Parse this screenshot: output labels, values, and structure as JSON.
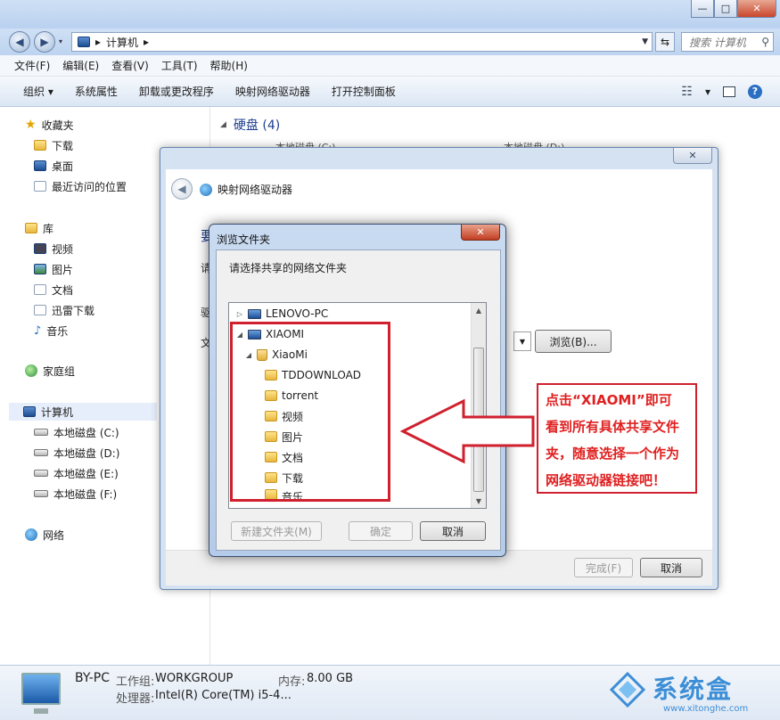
{
  "window": {
    "minimize": "—",
    "maximize": "□",
    "close": "✕"
  },
  "address": {
    "path": "计算机",
    "separator": "▸",
    "search_placeholder": "搜索 计算机"
  },
  "menu": [
    "文件(F)",
    "编辑(E)",
    "查看(V)",
    "工具(T)",
    "帮助(H)"
  ],
  "toolbar": {
    "organize": "组织 ▾",
    "items": [
      "系统属性",
      "卸载或更改程序",
      "映射网络驱动器",
      "打开控制面板"
    ],
    "view_dd": "▾"
  },
  "nav": {
    "favorites": "收藏夹",
    "favorites_items": [
      "下载",
      "桌面",
      "最近访问的位置"
    ],
    "libraries": "库",
    "libraries_items": [
      "视频",
      "图片",
      "文档",
      "迅雷下载",
      "音乐"
    ],
    "homegroup": "家庭组",
    "computer": "计算机",
    "drives": [
      "本地磁盘 (C:)",
      "本地磁盘 (D:)",
      "本地磁盘 (E:)",
      "本地磁盘 (F:)"
    ],
    "network": "网络"
  },
  "content": {
    "group_title": "硬盘 (4)",
    "drive_c": "本地磁盘 (C:)",
    "drive_d": "本地磁盘 (D:)"
  },
  "details": {
    "pc_name": "BY-PC",
    "workgroup_label": "工作组:",
    "workgroup_value": "WORKGROUP",
    "memory_label": "内存:",
    "memory_value": "8.00 GB",
    "cpu_label": "处理器:",
    "cpu_value": "Intel(R) Core(TM) i5-4..."
  },
  "map_dialog": {
    "title": "映射网络驱动器",
    "heading_partial": "要",
    "label_drive_partial": "驱",
    "label_folder_partial": "文",
    "label_instr_partial": "请",
    "browse_button": "浏览(B)...",
    "finish_button": "完成(F)",
    "cancel_button": "取消"
  },
  "browse_dialog": {
    "title": "浏览文件夹",
    "prompt": "请选择共享的网络文件夹",
    "tree": [
      {
        "label": "LENOVO-PC",
        "level": 0,
        "icon": "computer-icon",
        "toggle": "▷"
      },
      {
        "label": "XIAOMI",
        "level": 0,
        "icon": "computer-icon",
        "toggle": "◢"
      },
      {
        "label": "XiaoMi",
        "level": 1,
        "icon": "share-icon",
        "toggle": "◢"
      },
      {
        "label": "TDDOWNLOAD",
        "level": 2,
        "icon": "folder-icon",
        "toggle": ""
      },
      {
        "label": "torrent",
        "level": 2,
        "icon": "folder-icon",
        "toggle": ""
      },
      {
        "label": "视频",
        "level": 2,
        "icon": "folder-icon",
        "toggle": ""
      },
      {
        "label": "图片",
        "level": 2,
        "icon": "folder-icon",
        "toggle": ""
      },
      {
        "label": "文档",
        "level": 2,
        "icon": "folder-icon",
        "toggle": ""
      },
      {
        "label": "下载",
        "level": 2,
        "icon": "folder-icon",
        "toggle": ""
      },
      {
        "label": "音乐",
        "level": 2,
        "icon": "folder-icon",
        "toggle": ""
      }
    ],
    "new_folder_button": "新建文件夹(M)",
    "ok_button": "确定",
    "cancel_button": "取消"
  },
  "annotation": {
    "lines": [
      "点击“XIAOMI”即可",
      "看到所有具体共享文件",
      "夹，随意选择一个作为",
      "网络驱动器链接吧！"
    ],
    "color": "#d0202e"
  },
  "watermark": {
    "text": "系统盒",
    "url": "www.xitonghe.com"
  }
}
